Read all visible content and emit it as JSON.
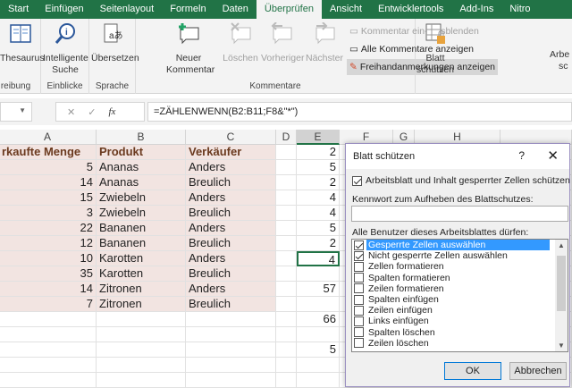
{
  "tabs": [
    "Start",
    "Einfügen",
    "Seitenlayout",
    "Formeln",
    "Daten",
    "Überprüfen",
    "Ansicht",
    "Entwicklertools",
    "Add-Ins",
    "Nitro"
  ],
  "active_tab": "Überprüfen",
  "ribbon": {
    "thesaurus": "Thesaurus",
    "group_rechtschreibung": "reibung",
    "smart_lookup_1": "Intelligente",
    "smart_lookup_2": "Suche",
    "group_einblicke": "Einblicke",
    "translate": "Übersetzen",
    "group_sprache": "Sprache",
    "new_comment_1": "Neuer",
    "new_comment_2": "Kommentar",
    "delete": "Löschen",
    "previous": "Vorheriger",
    "next": "Nächster",
    "toggle_comment": "Kommentar ein-/ausblenden",
    "show_all_comments": "Alle Kommentare anzeigen",
    "show_ink": "Freihandanmerkungen anzeigen",
    "group_kommentare": "Kommentare",
    "protect_sheet_1": "Blatt",
    "protect_sheet_2": "schützen",
    "protect_wb_1": "Arbe",
    "protect_wb_2": "sc"
  },
  "formula_bar": {
    "fx": "fx",
    "formula": "=ZÄHLENWENN(B2:B11;F8&\"*\")"
  },
  "columns": [
    "A",
    "B",
    "C",
    "D",
    "E",
    "F",
    "G",
    "H"
  ],
  "sheet": {
    "headers": [
      "rkaufte Menge",
      "Produkt",
      "Verkäufer"
    ],
    "rows": [
      [
        "5",
        "Ananas",
        "Anders"
      ],
      [
        "14",
        "Ananas",
        "Breulich"
      ],
      [
        "15",
        "Zwiebeln",
        "Anders"
      ],
      [
        "3",
        "Zwiebeln",
        "Breulich"
      ],
      [
        "22",
        "Bananen",
        "Anders"
      ],
      [
        "12",
        "Bananen",
        "Breulich"
      ],
      [
        "10",
        "Karotten",
        "Anders"
      ],
      [
        "35",
        "Karotten",
        "Breulich"
      ],
      [
        "14",
        "Zitronen",
        "Anders"
      ],
      [
        "7",
        "Zitronen",
        "Breulich"
      ]
    ],
    "col_e": [
      "2",
      "5",
      "2",
      "4",
      "4",
      "5",
      "2",
      "4",
      "",
      "57",
      "",
      "66",
      "",
      "5",
      "",
      ""
    ]
  },
  "dialog": {
    "title": "Blatt schützen",
    "help": "?",
    "close": "✕",
    "protect_label": "Arbeitsblatt und Inhalt gesperrter Zellen schützen",
    "protect_checked": true,
    "password_label": "Kennwort zum Aufheben des Blattschutzes:",
    "password_value": "",
    "allow_label": "Alle Benutzer dieses Arbeitsblattes dürfen:",
    "options": [
      {
        "label": "Gesperrte Zellen auswählen",
        "checked": true
      },
      {
        "label": "Nicht gesperrte Zellen auswählen",
        "checked": true
      },
      {
        "label": "Zellen formatieren",
        "checked": false
      },
      {
        "label": "Spalten formatieren",
        "checked": false
      },
      {
        "label": "Zeilen formatieren",
        "checked": false
      },
      {
        "label": "Spalten einfügen",
        "checked": false
      },
      {
        "label": "Zeilen einfügen",
        "checked": false
      },
      {
        "label": "Links einfügen",
        "checked": false
      },
      {
        "label": "Spalten löschen",
        "checked": false
      },
      {
        "label": "Zeilen löschen",
        "checked": false
      }
    ],
    "ok": "OK",
    "cancel": "Abbrechen"
  }
}
